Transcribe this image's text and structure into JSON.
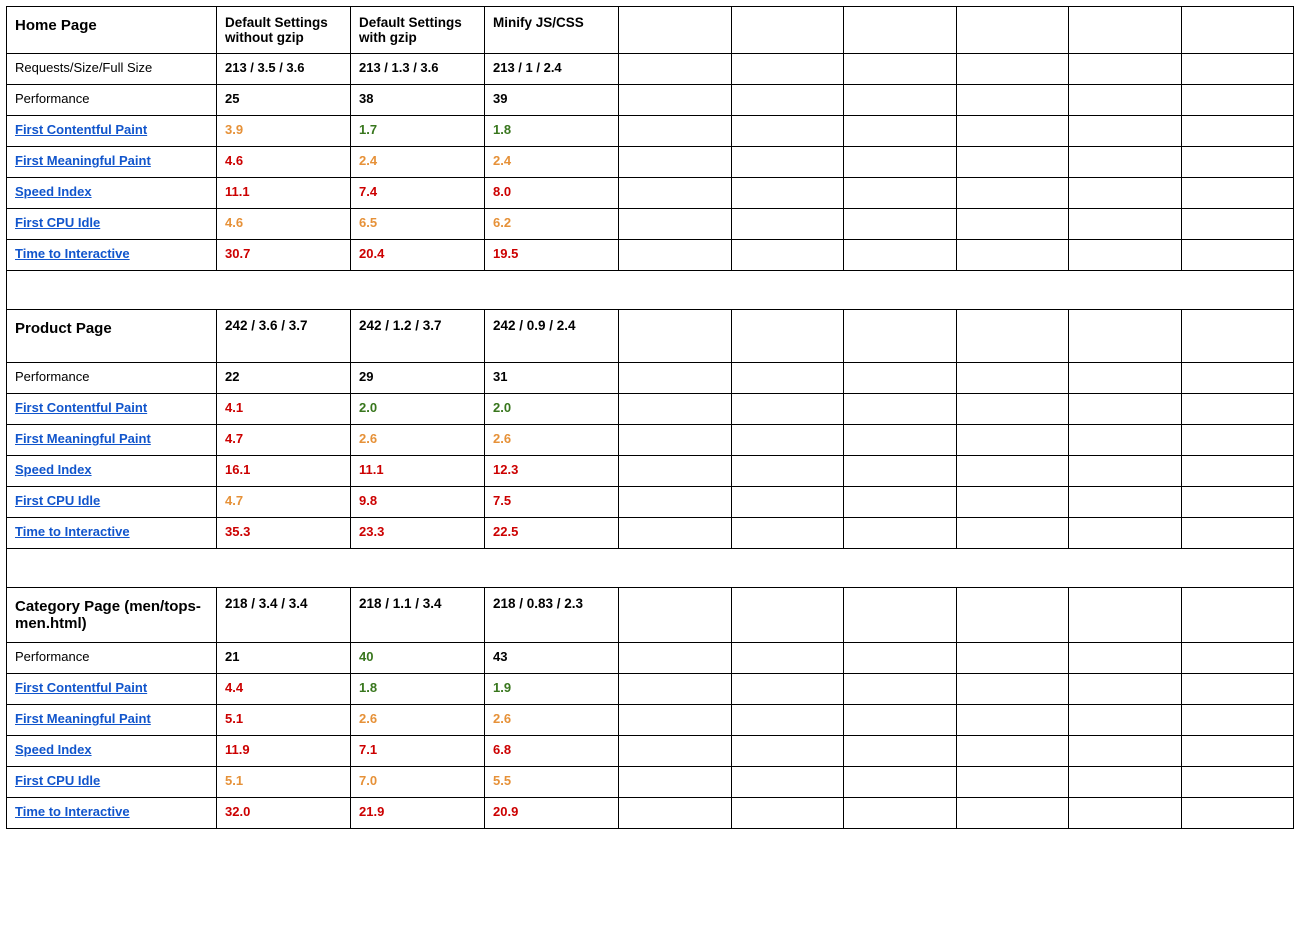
{
  "columns": {
    "c0_empty": "",
    "c1": "Default Settings without  gzip",
    "c2": "Default Settings with gzip",
    "c3": "Minify JS/CSS"
  },
  "metricLabels": {
    "reqs": "Requests/Size/Full Size",
    "perf": "Performance",
    "fcp": "First Contentful Paint",
    "fmp": "First Meaningful Paint",
    "si": "Speed Index",
    "cpu": "First CPU Idle",
    "tti": "Time to Interactive"
  },
  "sections": {
    "home": {
      "title": "Home Page",
      "reqs": {
        "c1": "213 / 3.5 / 3.6",
        "c2": "213 / 1.3 / 3.6",
        "c3": "213 / 1 / 2.4"
      },
      "perf": {
        "c1": {
          "v": "25",
          "c": "black"
        },
        "c2": {
          "v": "38",
          "c": "black"
        },
        "c3": {
          "v": "39",
          "c": "black"
        }
      },
      "fcp": {
        "c1": {
          "v": "3.9",
          "c": "orange"
        },
        "c2": {
          "v": "1.7",
          "c": "green"
        },
        "c3": {
          "v": "1.8",
          "c": "green"
        }
      },
      "fmp": {
        "c1": {
          "v": "4.6",
          "c": "red"
        },
        "c2": {
          "v": "2.4",
          "c": "orange"
        },
        "c3": {
          "v": "2.4",
          "c": "orange"
        }
      },
      "si": {
        "c1": {
          "v": "11.1",
          "c": "red"
        },
        "c2": {
          "v": "7.4",
          "c": "red"
        },
        "c3": {
          "v": "8.0",
          "c": "red"
        }
      },
      "cpu": {
        "c1": {
          "v": "4.6",
          "c": "orange"
        },
        "c2": {
          "v": "6.5",
          "c": "orange"
        },
        "c3": {
          "v": "6.2",
          "c": "orange"
        }
      },
      "tti": {
        "c1": {
          "v": "30.7",
          "c": "red"
        },
        "c2": {
          "v": "20.4",
          "c": "red"
        },
        "c3": {
          "v": "19.5",
          "c": "red"
        }
      }
    },
    "product": {
      "title": "Product Page",
      "reqs": {
        "c1": "242 / 3.6 / 3.7",
        "c2": "242 / 1.2 / 3.7",
        "c3": "242 / 0.9 / 2.4"
      },
      "perf": {
        "c1": {
          "v": "22",
          "c": "black"
        },
        "c2": {
          "v": "29",
          "c": "black"
        },
        "c3": {
          "v": "31",
          "c": "black"
        }
      },
      "fcp": {
        "c1": {
          "v": "4.1",
          "c": "red"
        },
        "c2": {
          "v": "2.0",
          "c": "green"
        },
        "c3": {
          "v": "2.0",
          "c": "green"
        }
      },
      "fmp": {
        "c1": {
          "v": "4.7",
          "c": "red"
        },
        "c2": {
          "v": "2.6",
          "c": "orange"
        },
        "c3": {
          "v": "2.6",
          "c": "orange"
        }
      },
      "si": {
        "c1": {
          "v": "16.1",
          "c": "red"
        },
        "c2": {
          "v": "11.1",
          "c": "red"
        },
        "c3": {
          "v": "12.3",
          "c": "red"
        }
      },
      "cpu": {
        "c1": {
          "v": "4.7",
          "c": "orange"
        },
        "c2": {
          "v": "9.8",
          "c": "red"
        },
        "c3": {
          "v": "7.5",
          "c": "red"
        }
      },
      "tti": {
        "c1": {
          "v": "35.3",
          "c": "red"
        },
        "c2": {
          "v": "23.3",
          "c": "red"
        },
        "c3": {
          "v": "22.5",
          "c": "red"
        }
      }
    },
    "category": {
      "title": "Category Page (men/tops-men.html)",
      "reqs": {
        "c1": "218 / 3.4 / 3.4",
        "c2": "218 / 1.1 / 3.4",
        "c3": "218 / 0.83 / 2.3"
      },
      "perf": {
        "c1": {
          "v": "21",
          "c": "black"
        },
        "c2": {
          "v": "40",
          "c": "green"
        },
        "c3": {
          "v": "43",
          "c": "black"
        }
      },
      "fcp": {
        "c1": {
          "v": "4.4",
          "c": "red"
        },
        "c2": {
          "v": "1.8",
          "c": "green"
        },
        "c3": {
          "v": "1.9",
          "c": "green"
        }
      },
      "fmp": {
        "c1": {
          "v": "5.1",
          "c": "red"
        },
        "c2": {
          "v": "2.6",
          "c": "orange"
        },
        "c3": {
          "v": "2.6",
          "c": "orange"
        }
      },
      "si": {
        "c1": {
          "v": "11.9",
          "c": "red"
        },
        "c2": {
          "v": "7.1",
          "c": "red"
        },
        "c3": {
          "v": "6.8",
          "c": "red"
        }
      },
      "cpu": {
        "c1": {
          "v": "5.1",
          "c": "orange"
        },
        "c2": {
          "v": "7.0",
          "c": "orange"
        },
        "c3": {
          "v": "5.5",
          "c": "orange"
        }
      },
      "tti": {
        "c1": {
          "v": "32.0",
          "c": "red"
        },
        "c2": {
          "v": "21.9",
          "c": "red"
        },
        "c3": {
          "v": "20.9",
          "c": "red"
        }
      }
    }
  }
}
